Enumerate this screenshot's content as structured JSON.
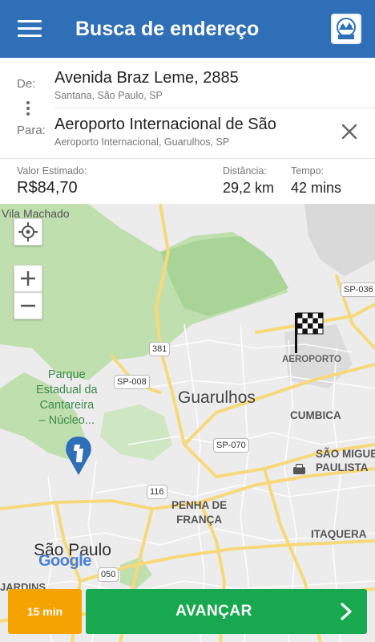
{
  "appbar": {
    "title": "Busca de endereço",
    "menu_icon": "hamburger-menu-icon",
    "logo_icon": "app-logo-icon",
    "color": "#2f6fb8"
  },
  "route": {
    "from_label": "De:",
    "from_main": "Avenida Braz Leme, 2885",
    "from_sub": "Santana, São Paulo, SP",
    "to_label": "Para:",
    "to_main": "Aeroporto Internacional de São",
    "to_sub": "Aeroporto Internacional, Guarulhos, SP"
  },
  "estimate": {
    "price_label": "Valor Estimado:",
    "price_value": "R$84,70",
    "distance_label": "Distância:",
    "distance_value": "29,2 km",
    "time_label": "Tempo:",
    "time_value": "42 mins"
  },
  "map": {
    "labels": {
      "vila_machado": "Vila Machado",
      "sp036": "SP-036",
      "rt381": "381",
      "sp008": "SP-008",
      "aeroporto": "AEROPORTO",
      "park": [
        "Parque",
        "Estadual da",
        "Cantareira",
        "– Núcleo..."
      ],
      "guarulhos": "Guarulhos",
      "cumbica": "CUMBICA",
      "sp070": "SP-070",
      "sao_miguel": [
        "SÃO MIGUE",
        "PAULISTA"
      ],
      "rt116": "116",
      "penha": [
        "PENHA DE",
        "FRANÇA"
      ],
      "itaquera": "ITAQUERA",
      "sao_paulo": "São Paulo",
      "jardins": "JARDINS",
      "rt050": "050",
      "google": "Google"
    },
    "colors": {
      "land": "#ececec",
      "green": "#bfdfae",
      "green_dark": "#a8d498",
      "road_yellow": "#f6d97a",
      "road_white": "#ffffff"
    }
  },
  "actions": {
    "time_button": "15 min",
    "next_button": "AVANÇAR",
    "time_color": "#f5a300",
    "next_color": "#18a950"
  }
}
